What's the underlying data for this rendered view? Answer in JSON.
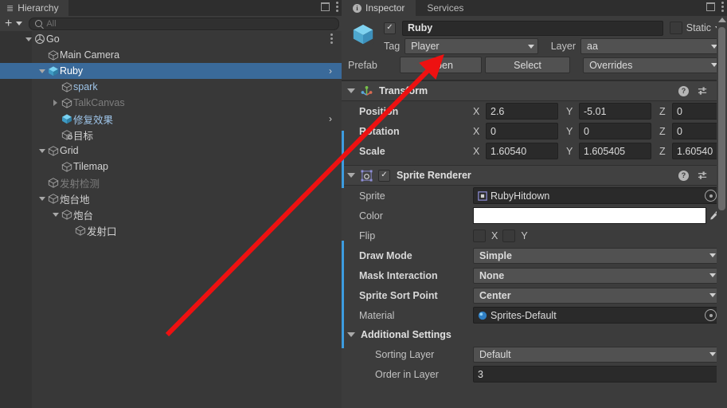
{
  "hierarchy": {
    "tab_label": "Hierarchy",
    "tab_icon": "hierarchy-icon",
    "toolbar": {
      "add_label": "+",
      "search_placeholder": "All",
      "search_value": ""
    },
    "items": [
      {
        "label": "Go",
        "depth": 0,
        "fold": "down",
        "icon": "scene-icon",
        "color": "white",
        "selected": false,
        "kebab": true
      },
      {
        "label": "Main Camera",
        "depth": 1,
        "fold": "none",
        "icon": "gameobject-icon",
        "color": "white",
        "selected": false
      },
      {
        "label": "Ruby",
        "depth": 1,
        "fold": "down",
        "icon": "prefab-icon",
        "color": "sel",
        "selected": true,
        "chevron": true
      },
      {
        "label": "spark",
        "depth": 2,
        "fold": "none",
        "icon": "gameobject-icon",
        "color": "blue",
        "selected": false
      },
      {
        "label": "TalkCanvas",
        "depth": 2,
        "fold": "right",
        "icon": "gameobject-icon",
        "color": "dim",
        "selected": false
      },
      {
        "label": "修复效果",
        "depth": 2,
        "fold": "none",
        "icon": "prefab-icon",
        "color": "blue",
        "selected": false,
        "chevron": true
      },
      {
        "label": "目标",
        "depth": 2,
        "fold": "none",
        "icon": "gameobject-add-icon",
        "color": "white",
        "selected": false
      },
      {
        "label": "Grid",
        "depth": 1,
        "fold": "down",
        "icon": "gameobject-icon",
        "color": "white",
        "selected": false
      },
      {
        "label": "Tilemap",
        "depth": 2,
        "fold": "none",
        "icon": "gameobject-icon",
        "color": "white",
        "selected": false
      },
      {
        "label": "发射检测",
        "depth": 1,
        "fold": "none",
        "icon": "gameobject-icon",
        "color": "dim",
        "selected": false
      },
      {
        "label": "炮台地",
        "depth": 1,
        "fold": "down",
        "icon": "gameobject-icon",
        "color": "white",
        "selected": false
      },
      {
        "label": "炮台",
        "depth": 2,
        "fold": "down",
        "icon": "gameobject-icon",
        "color": "white",
        "selected": false
      },
      {
        "label": "发射口",
        "depth": 3,
        "fold": "none",
        "icon": "gameobject-icon",
        "color": "white",
        "selected": false
      }
    ]
  },
  "inspector": {
    "tabs": [
      {
        "label": "Inspector",
        "active": true,
        "icon": "info-icon"
      },
      {
        "label": "Services",
        "active": false,
        "icon": ""
      }
    ],
    "object_header": {
      "enabled_checkbox": "✓",
      "name": "Ruby",
      "static_label": "Static",
      "tag_label": "Tag",
      "tag_value": "Player",
      "layer_label": "Layer",
      "layer_value": "aa",
      "prefab_label": "Prefab",
      "open_button": "Open",
      "select_button": "Select",
      "overrides_button": "Overrides"
    },
    "components": [
      {
        "title": "Transform",
        "icon": "transform-icon",
        "has_checkbox": false,
        "rows": [
          {
            "label": "Position",
            "bold": true,
            "type": "vector3",
            "axes": [
              "X",
              "Y",
              "Z"
            ],
            "values": [
              "2.6",
              "-5.01",
              "0"
            ]
          },
          {
            "label": "Rotation",
            "bold": true,
            "type": "vector3",
            "axes": [
              "X",
              "Y",
              "Z"
            ],
            "values": [
              "0",
              "0",
              "0"
            ]
          },
          {
            "label": "Scale",
            "bold": true,
            "type": "vector3",
            "axes": [
              "X",
              "Y",
              "Z"
            ],
            "values": [
              "1.60540",
              "1.605405",
              "1.60540"
            ]
          }
        ]
      },
      {
        "title": "Sprite Renderer",
        "icon": "sprite-renderer-icon",
        "has_checkbox": true,
        "checkbox": "✓",
        "rows": [
          {
            "label": "Sprite",
            "bold": false,
            "type": "object",
            "value": "RubyHitdown",
            "value_icon": "sprite-asset-icon"
          },
          {
            "label": "Color",
            "bold": false,
            "type": "color",
            "value": "#FFFFFF"
          },
          {
            "label": "Flip",
            "bold": false,
            "type": "flip",
            "x_label": "X",
            "y_label": "Y",
            "x": false,
            "y": false
          },
          {
            "label": "Draw Mode",
            "bold": true,
            "type": "dropdown",
            "value": "Simple"
          },
          {
            "label": "Mask Interaction",
            "bold": true,
            "type": "dropdown",
            "value": "None"
          },
          {
            "label": "Sprite Sort Point",
            "bold": true,
            "type": "dropdown",
            "value": "Center"
          },
          {
            "label": "Material",
            "bold": false,
            "type": "object",
            "value": "Sprites-Default",
            "value_icon": "material-icon"
          }
        ]
      }
    ],
    "additional_settings": {
      "title": "Additional Settings",
      "rows": [
        {
          "label": "Sorting Layer",
          "type": "dropdown",
          "value": "Default"
        },
        {
          "label": "Order in Layer",
          "type": "number",
          "value": "3"
        }
      ]
    }
  },
  "annotation": {
    "type": "arrow",
    "color": "#ee1111",
    "from": [
      210,
      420
    ],
    "to": [
      546,
      80
    ],
    "points_at": "open-button"
  },
  "colors": {
    "accent_selection": "#3a6a9a",
    "prefab_blue": "#3d9ce0",
    "panel_bg": "#3c3c3c",
    "hierarchy_bg": "#383838",
    "annotation_red": "#ee1111"
  }
}
